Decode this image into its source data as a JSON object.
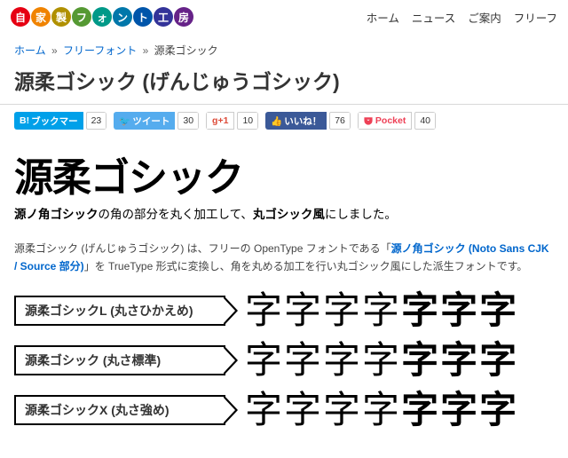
{
  "logo_chars": [
    "自",
    "家",
    "製",
    "フ",
    "ォ",
    "ン",
    "ト",
    "工",
    "房"
  ],
  "nav": [
    "ホーム",
    "ニュース",
    "ご案内",
    "フリーフ"
  ],
  "breadcrumb": {
    "home": "ホーム",
    "cat": "フリーフォント",
    "current": "源柔ゴシック"
  },
  "page_title": "源柔ゴシック (げんじゅうゴシック)",
  "share": {
    "bookmark": {
      "label": "ブックマー",
      "count": "23"
    },
    "tweet": {
      "label": "ツイート",
      "count": "30"
    },
    "gplus": {
      "label": "+1",
      "count": "10"
    },
    "like": {
      "label": "いいね！",
      "count": "76"
    },
    "pocket": {
      "label": "Pocket",
      "count": "40"
    }
  },
  "hero": {
    "title": "源柔ゴシック",
    "sub_bold1": "源ノ角ゴシック",
    "sub_mid": "の角の部分を丸く加工して、",
    "sub_bold2": "丸ゴシック風",
    "sub_end": "にしました。"
  },
  "desc": {
    "t1": "源柔ゴシック (げんじゅうゴシック) は、フリーの OpenType フォントである「",
    "link": "源ノ角ゴシック (Noto Sans CJK / Source 部分)",
    "t2": "」を TrueType 形式に変換し、角を丸める加工を行い丸ゴシック風にした派生フォントです。"
  },
  "variants": [
    {
      "label": "源柔ゴシックL (丸さひかえめ)"
    },
    {
      "label": "源柔ゴシック (丸さ標準)"
    },
    {
      "label": "源柔ゴシックX (丸さ強め)"
    }
  ],
  "glyph_char": "字"
}
